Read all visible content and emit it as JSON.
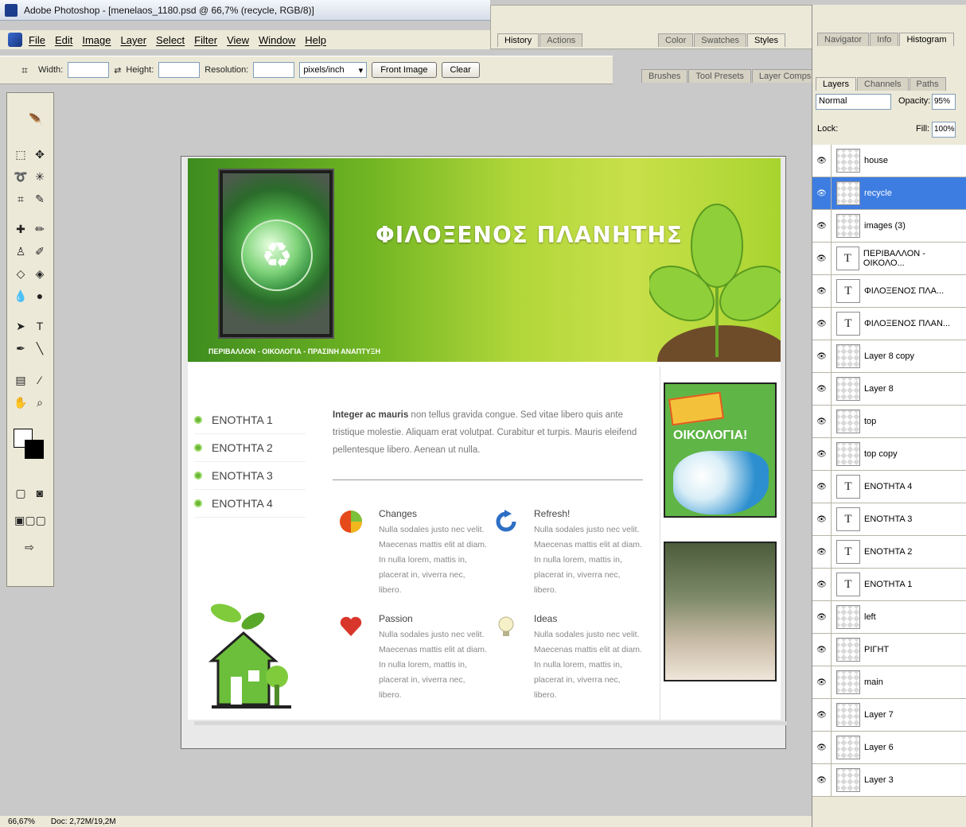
{
  "window": {
    "title": "Adobe Photoshop - [menelaos_1180.psd @ 66,7% (recycle, RGB/8)]"
  },
  "menu": [
    "File",
    "Edit",
    "Image",
    "Layer",
    "Select",
    "Filter",
    "View",
    "Window",
    "Help"
  ],
  "options": {
    "width_label": "Width:",
    "height_label": "Height:",
    "resolution_label": "Resolution:",
    "units": "pixels/inch",
    "front_image_button": "Front Image",
    "clear_button": "Clear"
  },
  "palettes": {
    "group1": [
      "History",
      "Actions"
    ],
    "group2": [
      "Color",
      "Swatches",
      "Styles"
    ],
    "group3": [
      "Brushes",
      "Tool Presets",
      "Layer Comps"
    ],
    "group4": [
      "Navigator",
      "Info",
      "Histogram"
    ],
    "layers_tabs": [
      "Layers",
      "Channels",
      "Paths"
    ]
  },
  "layers_panel": {
    "blend_mode": "Normal",
    "opacity_label": "Opacity:",
    "opacity": "95%",
    "lock_label": "Lock:",
    "fill_label": "Fill:",
    "fill": "100%",
    "layers": [
      {
        "name": "house",
        "type": "image",
        "selected": false
      },
      {
        "name": "recycle",
        "type": "image",
        "selected": true
      },
      {
        "name": "images (3)",
        "type": "image",
        "selected": false
      },
      {
        "name": "ΠΕΡΙΒΑΛΛΟΝ - ΟΙΚΟΛΟ...",
        "type": "text",
        "selected": false
      },
      {
        "name": "ΦΙΛΟΞΕΝΟΣ ΠΛΑ...",
        "type": "text",
        "selected": false
      },
      {
        "name": "ΦΙΛΟΞΕΝΟΣ ΠΛΑΝ...",
        "type": "text",
        "selected": false
      },
      {
        "name": "Layer 8 copy",
        "type": "image",
        "selected": false
      },
      {
        "name": "Layer 8",
        "type": "image",
        "selected": false
      },
      {
        "name": "top",
        "type": "image",
        "selected": false
      },
      {
        "name": "top copy",
        "type": "image",
        "selected": false
      },
      {
        "name": "ΕΝΟΤΗΤΑ 4",
        "type": "text",
        "selected": false
      },
      {
        "name": "ΕΝΟΤΗΤΑ 3",
        "type": "text",
        "selected": false
      },
      {
        "name": "ΕΝΟΤΗΤΑ 2",
        "type": "text",
        "selected": false
      },
      {
        "name": "ΕΝΟΤΗΤΑ 1",
        "type": "text",
        "selected": false
      },
      {
        "name": "left",
        "type": "image",
        "selected": false
      },
      {
        "name": "ΡΙΓΗΤ",
        "type": "image",
        "selected": false
      },
      {
        "name": "main",
        "type": "image",
        "selected": false
      },
      {
        "name": "Layer 7",
        "type": "image",
        "selected": false
      },
      {
        "name": "Layer 6",
        "type": "image",
        "selected": false
      },
      {
        "name": "Layer 3",
        "type": "image",
        "selected": false
      }
    ]
  },
  "site": {
    "title": "ΦΙΛΟΞΕΝΟΣ ΠΛΑΝΗΤΗΣ",
    "tagline": "ΠΕΡΙΒΑΛΛΟΝ - ΟΙΚΟΛΟΓΙΑ - ΠΡΑΣΙΝΗ ΑΝΑΠΤΥΞΗ",
    "nav": [
      "ΕΝΟΤΗΤΑ 1",
      "ΕΝΟΤΗΤΑ 2",
      "ΕΝΟΤΗΤΑ 3",
      "ΕΝΟΤΗΤΑ 4"
    ],
    "intro_bold": "Integer ac mauris",
    "intro_rest": " non tellus gravida congue. Sed vitae libero quis ante tristique molestie. Aliquam erat volutpat. Curabitur et turpis. Mauris eleifend pellentesque libero. Aenean ut nulla.",
    "features": [
      {
        "title": "Changes",
        "body": "Nulla sodales justo nec velit. Maecenas mattis elit at diam. In nulla lorem, mattis in, placerat in, viverra nec, libero.",
        "icon": "pie-chart-icon"
      },
      {
        "title": "Refresh!",
        "body": "Nulla sodales justo nec velit. Maecenas mattis elit at diam. In nulla lorem, mattis in, placerat in, viverra nec, libero.",
        "icon": "refresh-icon"
      },
      {
        "title": "Passion",
        "body": "Nulla sodales justo nec velit. Maecenas mattis elit at diam. In nulla lorem, mattis in, placerat in, viverra nec, libero.",
        "icon": "heart-icon"
      },
      {
        "title": "Ideas",
        "body": "Nulla sodales justo nec velit. Maecenas mattis elit at diam. In nulla lorem, mattis in, placerat in, viverra nec, libero.",
        "icon": "lightbulb-icon"
      }
    ],
    "ad1_text": "ΟΙΚΟΛΟΓΙΑ!"
  },
  "status": {
    "zoom": "66,67%",
    "doc": "Doc: 2,72M/19,2M"
  },
  "colors": {
    "header_green": "#6fb422",
    "layer_selected": "#3d7de2"
  }
}
